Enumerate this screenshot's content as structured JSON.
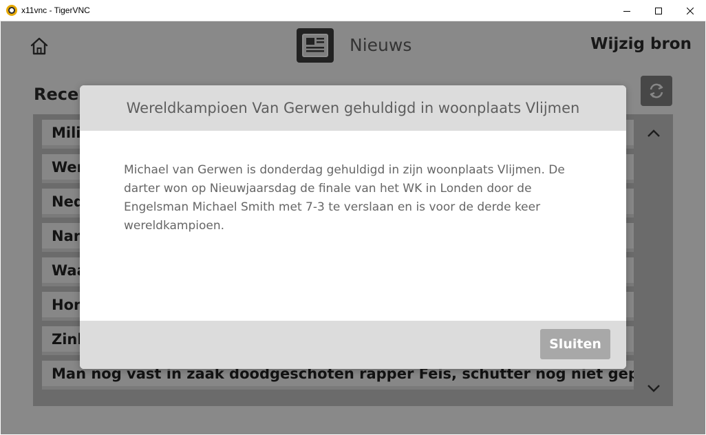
{
  "window": {
    "title": "x11vnc - TigerVNC"
  },
  "header": {
    "title": "Nieuws",
    "change_source": "Wijzig bron"
  },
  "recent": {
    "title": "Recen"
  },
  "news_items": [
    "Milit",
    "Wer",
    "Ned",
    "Nan",
    "Waa",
    "Hon",
    "Zink",
    "Man nog vast in zaak doodgeschoten rapper Feis, schutter nog niet gepakt"
  ],
  "modal": {
    "title": "Wereldkampioen Van Gerwen gehuldigd in woonplaats Vlijmen",
    "body": "Michael van Gerwen is donderdag gehuldigd in zijn woonplaats Vlijmen. De darter won op Nieuwjaarsdag de finale van het WK in Londen door de Engelsman Michael Smith met 7-3 te verslaan en is voor de derde keer wereldkampioen.",
    "close_label": "Sluiten"
  },
  "icons": {
    "home": "home-icon",
    "news": "newspaper-icon",
    "refresh": "refresh-icon",
    "scroll_up": "chevron-up-icon",
    "scroll_down": "chevron-down-icon"
  }
}
